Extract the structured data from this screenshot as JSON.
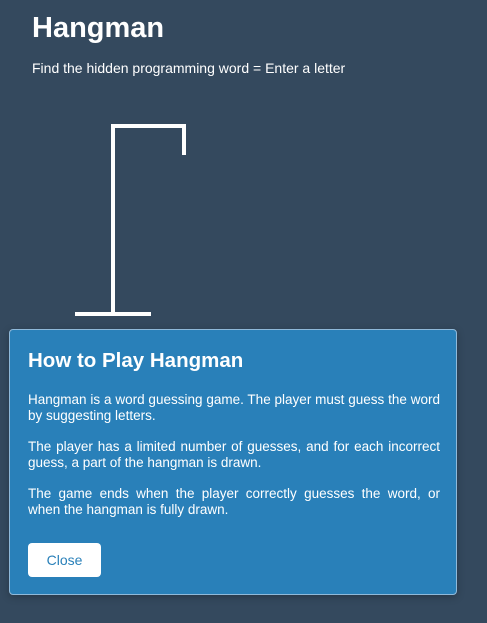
{
  "header": {
    "title": "Hangman",
    "subtitle": "Find the hidden programming word = Enter a letter"
  },
  "gallows": {
    "stroke_color": "#ffffff",
    "figure_parts_drawn": 0
  },
  "modal": {
    "title": "How to Play Hangman",
    "paragraphs": [
      "Hangman is a word guessing game. The player must guess the word by suggesting letters.",
      "The player has a limited number of guesses, and for each incorrect guess, a part of the hangman is drawn.",
      "The game ends when the player correctly guesses the word, or when the hangman is fully drawn."
    ],
    "close_label": "Close"
  },
  "colors": {
    "background": "#34495e",
    "modal_background": "#2980b9",
    "text": "#ffffff"
  }
}
